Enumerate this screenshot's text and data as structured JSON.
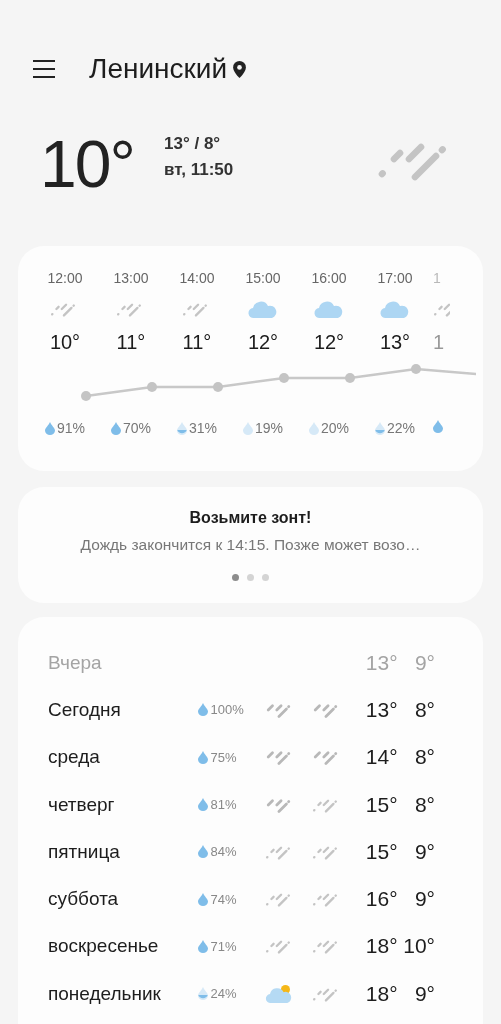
{
  "header": {
    "location": "Ленинский"
  },
  "current": {
    "temperature": "10°",
    "high_low": "13° / 8°",
    "datetime": "вт, 11:50",
    "icon": {
      "kind": "rain"
    }
  },
  "hourly": [
    {
      "time": "12:00",
      "icon": {
        "kind": "rain"
      },
      "temperature": "10°",
      "drop": {
        "kind": "full"
      },
      "precipitation": "91%"
    },
    {
      "time": "13:00",
      "icon": {
        "kind": "rain"
      },
      "temperature": "11°",
      "drop": {
        "kind": "full"
      },
      "precipitation": "70%"
    },
    {
      "time": "14:00",
      "icon": {
        "kind": "rain"
      },
      "temperature": "11°",
      "drop": {
        "kind": "half"
      },
      "precipitation": "31%"
    },
    {
      "time": "15:00",
      "icon": {
        "kind": "cloud"
      },
      "temperature": "12°",
      "drop": {
        "kind": "light"
      },
      "precipitation": "19%"
    },
    {
      "time": "16:00",
      "icon": {
        "kind": "cloud"
      },
      "temperature": "12°",
      "drop": {
        "kind": "light"
      },
      "precipitation": "20%"
    },
    {
      "time": "17:00",
      "icon": {
        "kind": "cloud"
      },
      "temperature": "13°",
      "drop": {
        "kind": "half"
      },
      "precipitation": "22%"
    },
    {
      "time": "1",
      "icon": {
        "kind": "rain"
      },
      "temperature": "1",
      "drop": {
        "kind": "full"
      }
    }
  ],
  "alert": {
    "title": "Возьмите зонт!",
    "text": "Дождь закончится к 14:15. Позже может возо…",
    "pages": [
      {
        "selected": true
      },
      {
        "selected": false
      },
      {
        "selected": false
      }
    ]
  },
  "daily": [
    {
      "kind": "past",
      "day": "Вчера",
      "high": "13°",
      "low": "9°"
    },
    {
      "kind": "day",
      "day": "Сегодня",
      "drop": {
        "kind": "full"
      },
      "precipitation": "100%",
      "day_icon": {
        "kind": "rain-heavy"
      },
      "night_icon": {
        "kind": "rain-heavy"
      },
      "high": "13°",
      "low": "8°"
    },
    {
      "kind": "day",
      "day": "среда",
      "drop": {
        "kind": "full"
      },
      "precipitation": "75%",
      "day_icon": {
        "kind": "rain-heavy"
      },
      "night_icon": {
        "kind": "rain-heavy"
      },
      "high": "14°",
      "low": "8°"
    },
    {
      "kind": "day",
      "day": "четверг",
      "drop": {
        "kind": "full"
      },
      "precipitation": "81%",
      "day_icon": {
        "kind": "rain-heavy"
      },
      "night_icon": {
        "kind": "rain-light"
      },
      "high": "15°",
      "low": "8°"
    },
    {
      "kind": "day",
      "day": "пятница",
      "drop": {
        "kind": "full"
      },
      "precipitation": "84%",
      "day_icon": {
        "kind": "rain-light"
      },
      "night_icon": {
        "kind": "rain-light"
      },
      "high": "15°",
      "low": "9°"
    },
    {
      "kind": "day",
      "day": "суббота",
      "drop": {
        "kind": "full"
      },
      "precipitation": "74%",
      "day_icon": {
        "kind": "rain-light"
      },
      "night_icon": {
        "kind": "rain-light"
      },
      "high": "16°",
      "low": "9°"
    },
    {
      "kind": "day",
      "day": "воскресенье",
      "drop": {
        "kind": "full"
      },
      "precipitation": "71%",
      "day_icon": {
        "kind": "rain-light"
      },
      "night_icon": {
        "kind": "rain-light"
      },
      "high": "18°",
      "low": "10°"
    },
    {
      "kind": "day",
      "day": "понедельник",
      "drop": {
        "kind": "half"
      },
      "precipitation": "24%",
      "day_icon": {
        "kind": "partly-sunny"
      },
      "night_icon": {
        "kind": "rain-light"
      },
      "high": "18°",
      "low": "9°"
    }
  ]
}
